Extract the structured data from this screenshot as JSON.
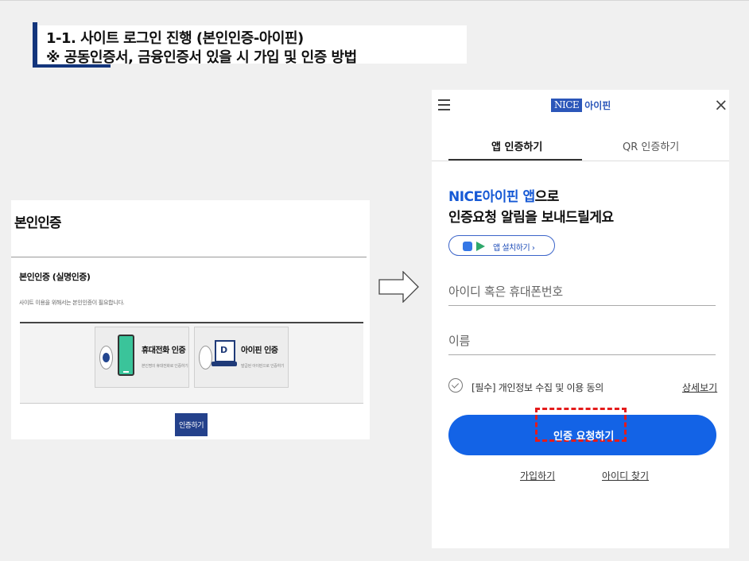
{
  "slide": {
    "title_line1": "1-1. 사이트 로그인 진행 (본인인증-아이핀)",
    "title_line2": "※ 공동인증서, 금융인증서 있을 시 가입 및 인증 방법",
    "accent_color": "#13357c"
  },
  "verification_page": {
    "title": "본인인증",
    "subtitle": "본인인증 (실명인증)",
    "description": "사이트 이용을 위해서는 본인인증이 필요합니다.",
    "options": [
      {
        "label": "휴대전화 인증",
        "sub": "본인명의 휴대전화로 인증하기",
        "icon": "mobile-phone-icon",
        "selected": true
      },
      {
        "label": "아이핀 인증",
        "sub": "발급된 아이핀으로 인증하기",
        "icon": "laptop-ipin-icon",
        "selected": false
      }
    ],
    "submit_label": "인증하기",
    "button_color": "#24418b"
  },
  "arrow": {
    "icon": "right-arrow-icon"
  },
  "nice_app": {
    "menu_icon": "hamburger-menu-icon",
    "logo_box": "NICE",
    "logo_text": "아이핀",
    "close_icon": "close-icon",
    "tabs": [
      {
        "label": "앱 인증하기",
        "active": true
      },
      {
        "label": "QR 인증하기",
        "active": false
      }
    ],
    "headline_brand": "NICE아이핀 앱",
    "headline_rest1": "으로",
    "headline_line2": "인증요청 알림을 보내드릴게요",
    "install_label": "앱 설치하기 ›",
    "id_placeholder": "아이디 혹은 휴대폰번호",
    "name_placeholder": "이름",
    "agree_text": "[필수] 개인정보 수집 및 이용 동의",
    "detail_link": "상세보기",
    "request_button": "인증 요청하기",
    "signup_link": "가입하기",
    "find_id_link": "아이디 찾기",
    "brand_color": "#1363e6",
    "highlight_color": "#e41b1b"
  }
}
